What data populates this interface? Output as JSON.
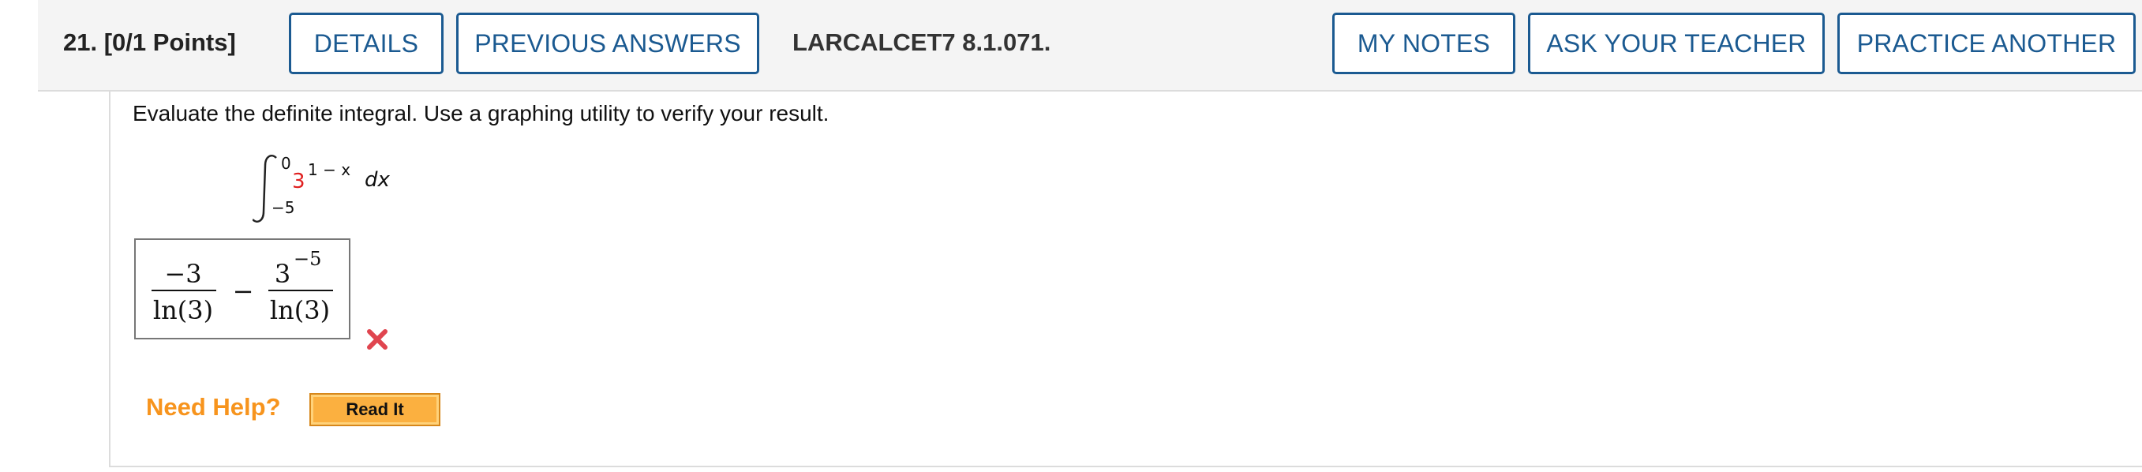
{
  "header": {
    "question_number": "21.",
    "points": "[0/1 Points]",
    "details_label": "DETAILS",
    "previous_answers_label": "PREVIOUS ANSWERS",
    "question_id": "LARCALCET7 8.1.071.",
    "my_notes_label": "MY NOTES",
    "ask_teacher_label": "ASK YOUR TEACHER",
    "practice_another_label": "PRACTICE ANOTHER"
  },
  "question": {
    "prompt": "Evaluate the definite integral. Use a graphing utility to verify your result.",
    "integral": {
      "upper_limit": "0",
      "lower_limit": "−5",
      "base": "3",
      "exponent": "1 − x",
      "differential": "dx"
    }
  },
  "answer": {
    "term1_numerator": "−3",
    "term1_denominator": "ln(3)",
    "operator": "−",
    "term2_base": "3",
    "term2_exponent": "−5",
    "term2_denominator": "ln(3)",
    "status": "incorrect"
  },
  "help": {
    "label": "Need Help?",
    "read_it_label": "Read It"
  },
  "colors": {
    "button_border": "#1b5a91",
    "incorrect_mark": "#e0454f",
    "need_help": "#f7941d",
    "read_it_bg": "#fbb040",
    "integral_base": "#e02020"
  }
}
